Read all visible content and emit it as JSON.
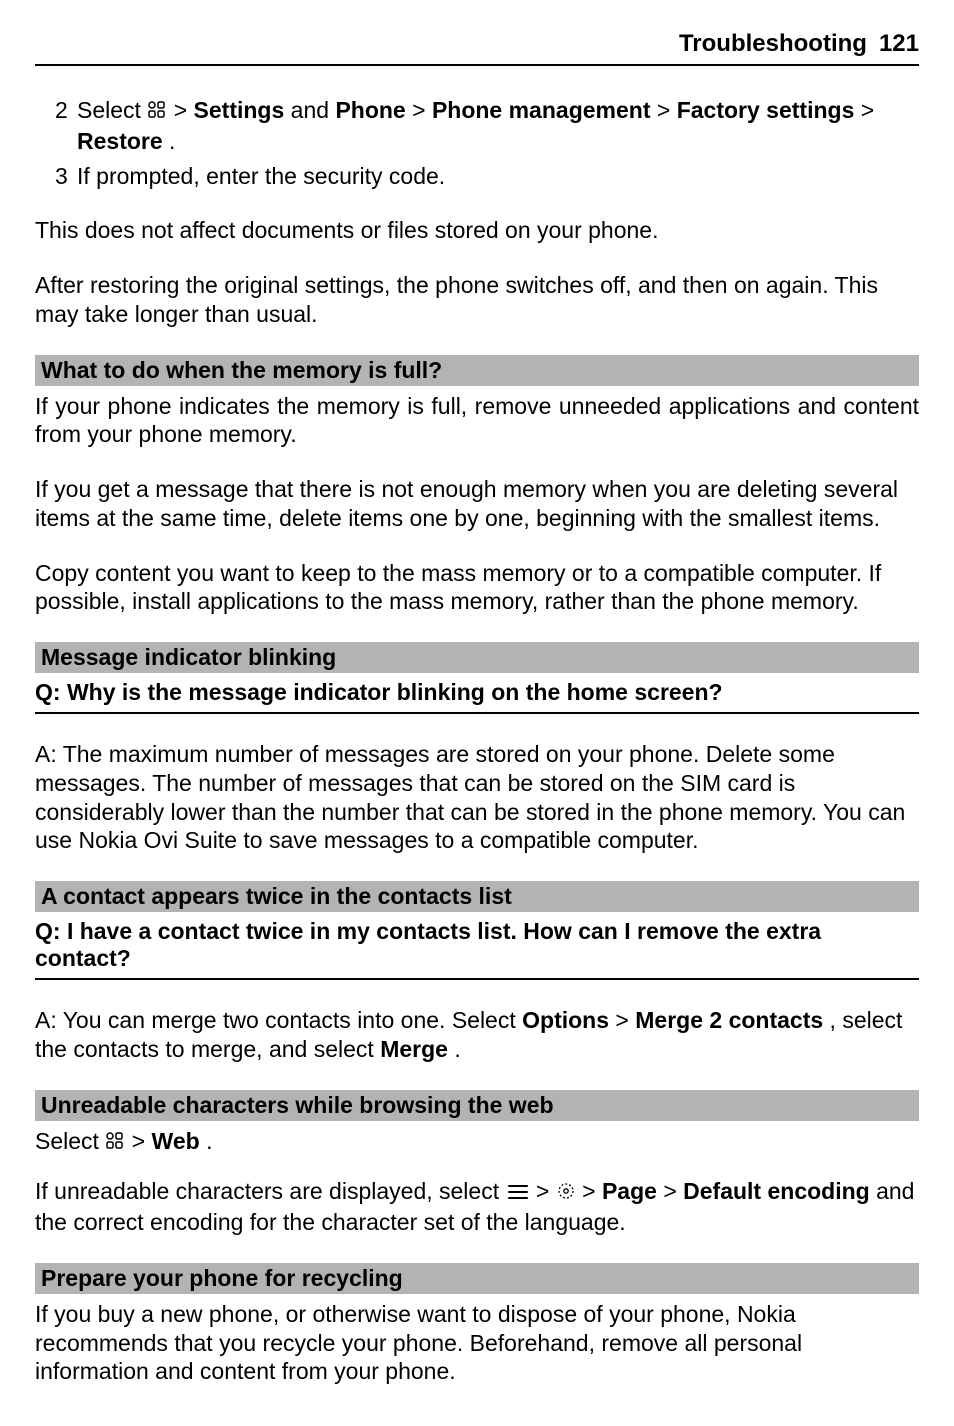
{
  "header": {
    "section": "Troubleshooting",
    "page_number": "121"
  },
  "steps": {
    "step2": {
      "num": "2",
      "t1": "Select ",
      "t2": " > ",
      "settings": "Settings",
      "t3": " and ",
      "phone": "Phone",
      "t4": " > ",
      "pm": "Phone management",
      "t5": " > ",
      "fs": "Factory settings",
      "t6": " > ",
      "restore": "Restore",
      "t7": "."
    },
    "step3": {
      "num": "3",
      "text": "If prompted, enter the security code."
    }
  },
  "p_no_affect": "This does not affect documents or files stored on your phone.",
  "p_after_restore": "After restoring the original settings, the phone switches off, and then on again. This may take longer than usual.",
  "memory": {
    "title": "What to do when the memory is full?",
    "p1": "If your phone indicates the memory is full, remove unneeded applications and content from your phone memory.",
    "p2": "If you get a message that there is not enough memory when you are deleting several items at the same time, delete items one by one, beginning with the smallest items.",
    "p3": "Copy content you want to keep to the mass memory or to a compatible computer. If possible, install applications to the mass memory, rather than the phone memory."
  },
  "msg_indicator": {
    "title": "Message indicator blinking",
    "q": "Q: Why is the message indicator blinking on the home screen?",
    "a": "A: The maximum number of messages are stored on your phone. Delete some messages. The number of messages that can be stored on the SIM card is considerably lower than the number that can be stored in the phone memory. You can use Nokia Ovi Suite to save messages to a compatible computer."
  },
  "dup_contact": {
    "title": "A contact appears twice in the contacts list",
    "q": "Q: I have a contact twice in my contacts list. How can I remove the extra contact?",
    "a1": "A: You can merge two contacts into one. Select ",
    "options": "Options",
    "a2": " > ",
    "merge2": "Merge 2 contacts",
    "a3": ", select the contacts to merge, and select ",
    "merge": "Merge",
    "a4": "."
  },
  "unreadable": {
    "title": "Unreadable characters while browsing the web",
    "l1a": "Select ",
    "l1b": " > ",
    "web": "Web",
    "l1c": ".",
    "l2a": "If unreadable characters are displayed, select ",
    "l2b": " > ",
    "l2c": " > ",
    "page": "Page",
    "l2d": " > ",
    "def_enc": "Default encoding",
    "l2e": " and the correct encoding for the character set of the language."
  },
  "recycle": {
    "title": "Prepare your phone for recycling",
    "p": "If you buy a new phone, or otherwise want to dispose of your phone, Nokia recommends that you recycle your phone. Beforehand, remove all personal information and content from your phone."
  }
}
